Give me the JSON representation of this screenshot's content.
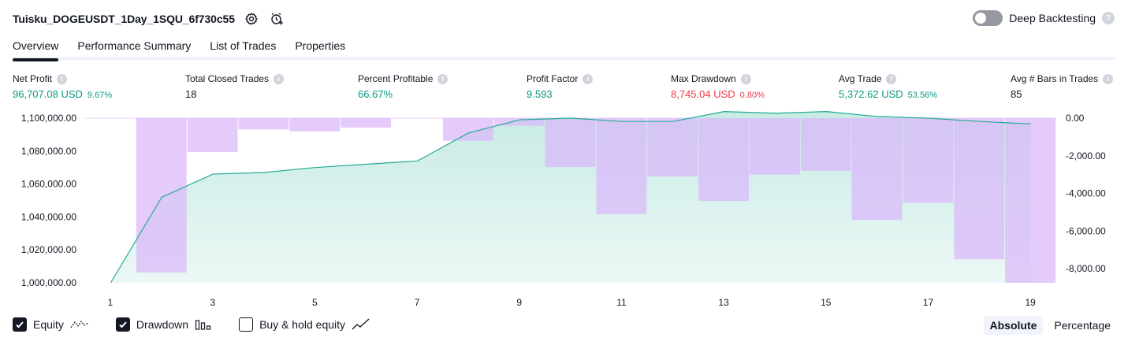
{
  "header": {
    "title": "Tuisku_DOGEUSDT_1Day_1SQU_6f730c55",
    "deep_backtesting_label": "Deep Backtesting",
    "help_glyph": "?"
  },
  "tabs": [
    {
      "label": "Overview",
      "active": true
    },
    {
      "label": "Performance Summary",
      "active": false
    },
    {
      "label": "List of Trades",
      "active": false
    },
    {
      "label": "Properties",
      "active": false
    }
  ],
  "metrics": {
    "net_profit": {
      "label": "Net Profit",
      "value": "96,707.08 USD",
      "pct": "9.67%"
    },
    "total_closed_trades": {
      "label": "Total Closed Trades",
      "value": "18"
    },
    "percent_profitable": {
      "label": "Percent Profitable",
      "value": "66.67%"
    },
    "profit_factor": {
      "label": "Profit Factor",
      "value": "9.593"
    },
    "max_drawdown": {
      "label": "Max Drawdown",
      "value": "8,745.04 USD",
      "pct": "0.80%"
    },
    "avg_trade": {
      "label": "Avg Trade",
      "value": "5,372.62 USD",
      "pct": "53.56%"
    },
    "avg_bars": {
      "label": "Avg # Bars in Trades",
      "value": "85"
    }
  },
  "chart_data": {
    "type": "area",
    "x": [
      1,
      2,
      3,
      4,
      5,
      6,
      7,
      8,
      9,
      10,
      11,
      12,
      13,
      14,
      15,
      16,
      17,
      18,
      19
    ],
    "x_ticks": [
      "1",
      "3",
      "5",
      "7",
      "9",
      "11",
      "13",
      "15",
      "17",
      "19"
    ],
    "equity": [
      992000,
      1052000,
      1066000,
      1067000,
      1070000,
      1072000,
      1074000,
      1091000,
      1099000,
      1100000,
      1098000,
      1098000,
      1104000,
      1103000,
      1104000,
      1101000,
      1100000,
      1098000,
      1096500
    ],
    "drawdown": [
      0,
      -8200,
      -1800,
      -600,
      -700,
      -500,
      0,
      -1200,
      -400,
      -2600,
      -5100,
      -3100,
      -4400,
      -3000,
      -2800,
      -5400,
      -4500,
      -7500,
      -8745
    ],
    "left_ylim": [
      1000000,
      1100000
    ],
    "left_ticks": [
      "1,000,000.00",
      "1,020,000.00",
      "1,040,000.00",
      "1,060,000.00",
      "1,080,000.00",
      "1,100,000.00"
    ],
    "right_ylim": [
      -8745,
      0
    ],
    "right_ticks": [
      "0.00",
      "-2,000.00",
      "-4,000.00",
      "-6,000.00",
      "-8,000.00"
    ],
    "colors": {
      "equity_line": "#22ab94",
      "equity_fill": "#c8ebe4",
      "drawdown": "#d9b7fb"
    }
  },
  "legend": {
    "equity": {
      "label": "Equity",
      "checked": true
    },
    "drawdown": {
      "label": "Drawdown",
      "checked": true
    },
    "buy_hold": {
      "label": "Buy & hold equity",
      "checked": false
    }
  },
  "scale": {
    "absolute_label": "Absolute",
    "percentage_label": "Percentage"
  }
}
